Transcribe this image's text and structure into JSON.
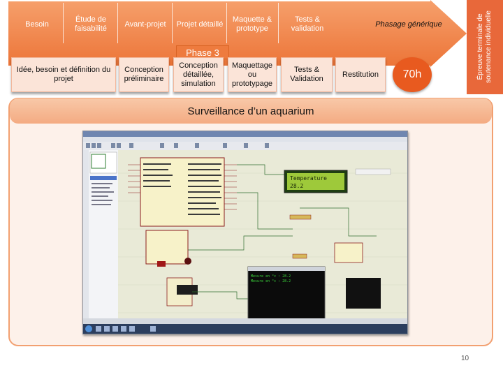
{
  "phases_top": [
    {
      "label": "Besoin"
    },
    {
      "label": "Étude de faisabilité"
    },
    {
      "label": "Avant-projet"
    },
    {
      "label": "Projet détaillé"
    },
    {
      "label": "Maquette & prototype"
    },
    {
      "label": "Tests & validation"
    }
  ],
  "phasage_label": "Phasage générique",
  "phase3_label": "Phase 3",
  "steps": [
    {
      "label": "Idée, besoin et définition du projet"
    },
    {
      "label": "Conception préliminaire"
    },
    {
      "label": "Conception détaillée, simulation"
    },
    {
      "label": "Maquettage ou prototypage"
    },
    {
      "label": "Tests & Validation"
    },
    {
      "label": "Restitution"
    }
  ],
  "duration": "70h",
  "epreuve_label": "Épreuve terminale de soutenance individuelle",
  "project_title": "Surveillance d’un aquarium",
  "screenshot": {
    "lcd_line1": "Temperature",
    "lcd_line2": "28.2",
    "terminal_line1": "Mesure en °c : 28.2",
    "terminal_line2": "Mesure en °c : 28.2"
  },
  "page_number": "10",
  "colors": {
    "arrow": "#f07c3e",
    "accent": "#e85a1f",
    "box_fill": "#fbe4d8",
    "panel_border": "#f2a071"
  }
}
